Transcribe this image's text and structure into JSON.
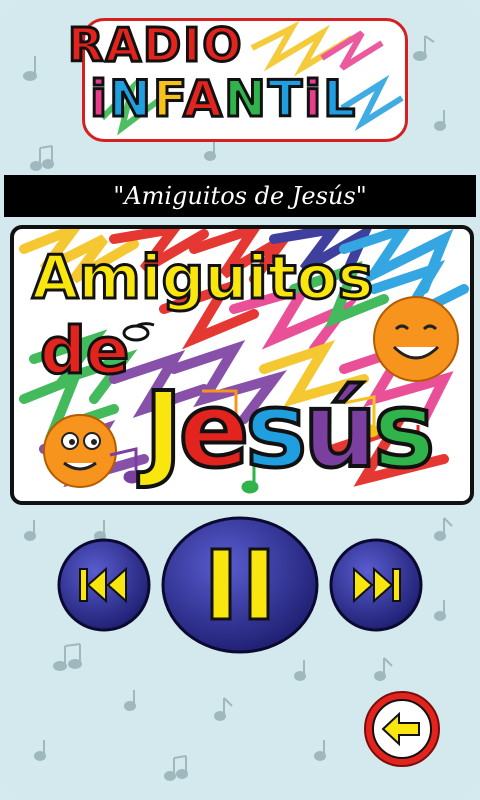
{
  "app": {
    "logo_line1": "RADIO",
    "logo_line2": [
      "i",
      "N",
      "F",
      "A",
      "N",
      "T",
      "i",
      "L"
    ]
  },
  "station": {
    "title": "\"Amiguitos de Jesús\""
  },
  "cover": {
    "line1": "Amiguitos",
    "line2": "de",
    "line3": [
      "J",
      "e",
      "s",
      "ú",
      "s"
    ]
  },
  "controls": {
    "previous_icon": "skip-previous-icon",
    "pause_icon": "pause-icon",
    "next_icon": "skip-next-icon",
    "back_icon": "arrow-left-icon"
  },
  "colors": {
    "background": "#d3e9ee",
    "button_blue": "#2b2c94",
    "button_yellow": "#f8e60e",
    "back_red": "#e3231d"
  }
}
